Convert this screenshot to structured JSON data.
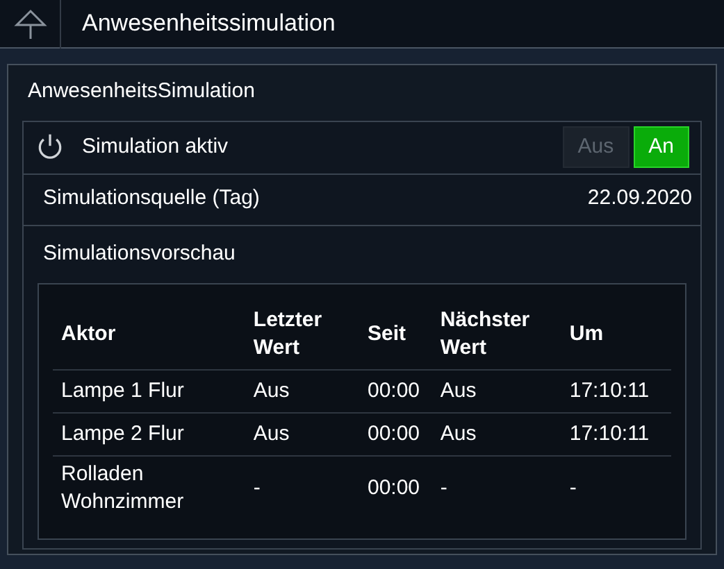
{
  "header": {
    "title": "Anwesenheitssimulation"
  },
  "panel": {
    "title": "AnwesenheitsSimulation",
    "toggle": {
      "label": "Simulation aktiv",
      "options": [
        {
          "label": "Aus",
          "selected": false
        },
        {
          "label": "An",
          "selected": true
        }
      ]
    },
    "source": {
      "label": "Simulationsquelle (Tag)",
      "value": "22.09.2020"
    },
    "preview": {
      "label": "Simulationsvorschau",
      "table": {
        "columns": [
          "Aktor",
          "Letzter Wert",
          "Seit",
          "Nächster Wert",
          "Um"
        ],
        "rows": [
          [
            "Lampe 1 Flur",
            "Aus",
            "00:00",
            "Aus",
            "17:10:11"
          ],
          [
            "Lampe 2 Flur",
            "Aus",
            "00:00",
            "Aus",
            "17:10:11"
          ],
          [
            "Rolladen Wohnzimmer",
            "-",
            "00:00",
            "-",
            "-"
          ]
        ]
      }
    }
  }
}
